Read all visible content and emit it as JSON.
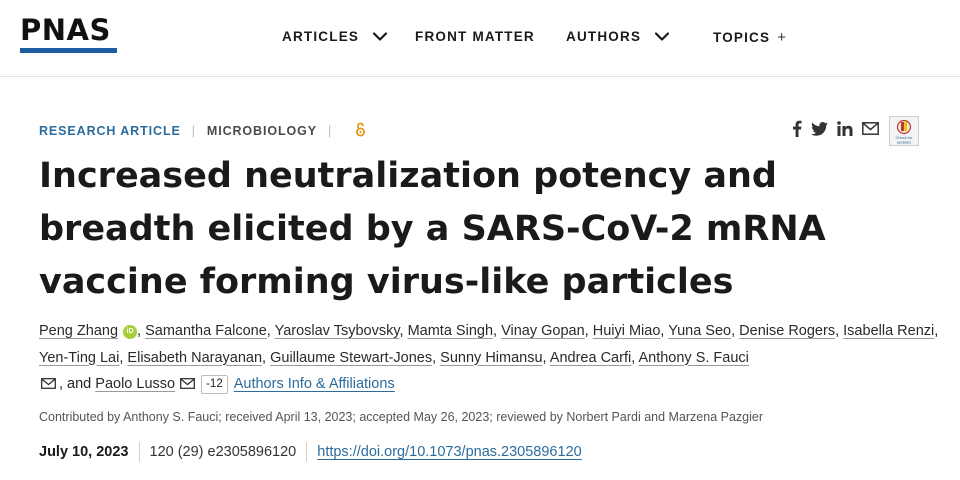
{
  "header": {
    "logo": "PNAS",
    "nav": [
      {
        "label": "ARTICLES",
        "control": "chevron-down"
      },
      {
        "label": "FRONT MATTER"
      },
      {
        "label": "AUTHORS",
        "control": "chevron-down"
      },
      {
        "label": "TOPICS",
        "control": "+"
      }
    ]
  },
  "article": {
    "type": "RESEARCH ARTICLE",
    "subject": "MICROBIOLOGY",
    "open_access_icon": "open-access-lock-icon",
    "share_icons": [
      "facebook-icon",
      "twitter-icon",
      "linkedin-icon",
      "email-icon",
      "crossmark-icon"
    ],
    "crossmark_label": "Check for updates",
    "title": "Increased neutralization potency and breadth elicited by a SARS-CoV-2 mRNA vaccine forming virus-like particles",
    "authors": [
      "Peng Zhang",
      "Samantha Falcone",
      "Yaroslav Tsybovsky",
      "Mamta Singh",
      "Vinay Gopan",
      "Huiyi Miao",
      "Yuna Seo",
      "Denise Rogers",
      "Isabella Renzi",
      "Yen-Ting Lai",
      "Elisabeth Narayanan",
      "Guillaume Stewart-Jones",
      "Sunny Himansu",
      "Andrea Carfi",
      "Anthony S. Fauci",
      "Paolo Lusso"
    ],
    "orcid_label": "iD",
    "and_text": ", and",
    "more_authors_count": "-12",
    "authors_info_link": "Authors Info & Affiliations",
    "contributed": "Contributed by Anthony S. Fauci; received April 13, 2023; accepted May 26, 2023; reviewed by Norbert Pardi and Marzena Pazgier",
    "date": "July 10, 2023",
    "citation": "120 (29) e2305896120",
    "doi": "https://doi.org/10.1073/pnas.2305896120"
  },
  "colors": {
    "accent_blue": "#2b6c9c",
    "logo_bar": "#1f5da3",
    "orcid_green": "#a6ce39",
    "open_access_orange": "#e8940f"
  }
}
